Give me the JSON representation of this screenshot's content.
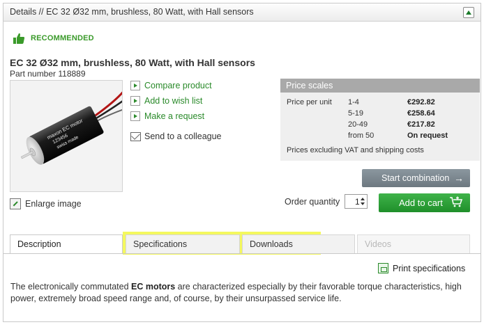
{
  "header": {
    "title": "Details // EC 32 Ø32 mm, brushless, 80 Watt, with Hall sensors"
  },
  "badge": {
    "label": "RECOMMENDED"
  },
  "product": {
    "title": "EC 32 Ø32 mm, brushless, 80 Watt, with Hall sensors",
    "part_number": "Part number 118889",
    "image_text": {
      "line1": "maxon EC motor",
      "line2": "123456",
      "line3": "swiss made"
    }
  },
  "actions": {
    "compare": "Compare product",
    "wishlist": "Add to wish list",
    "request": "Make a request",
    "send": "Send to a colleague",
    "enlarge": "Enlarge image",
    "print": "Print specifications"
  },
  "price_scales": {
    "title": "Price scales",
    "label": "Price per unit",
    "rows": [
      {
        "range": "1-4",
        "price": "€292.82"
      },
      {
        "range": "5-19",
        "price": "€258.64"
      },
      {
        "range": "20-49",
        "price": "€217.82"
      },
      {
        "range": "from 50",
        "price": "On request"
      }
    ],
    "note": "Prices excluding VAT and shipping costs"
  },
  "order": {
    "combination_label": "Start combination",
    "quantity_label": "Order quantity",
    "quantity_value": "1",
    "cart_label": "Add to cart"
  },
  "tabs": [
    {
      "label": "Description"
    },
    {
      "label": "Specifications"
    },
    {
      "label": "Downloads"
    },
    {
      "label": "Videos"
    }
  ],
  "description": {
    "part1": "The electronically commutated ",
    "bold": "EC motors",
    "part2": " are characterized especially by their favorable torque characteristics, high power, extremely broad speed range and, of course, by their unsurpassed service life."
  },
  "colors": {
    "accent_green": "#2a8a2a",
    "cart_green": "#2a9a34",
    "highlight": "#f0f528",
    "header_gray": "#a9a9a9"
  }
}
